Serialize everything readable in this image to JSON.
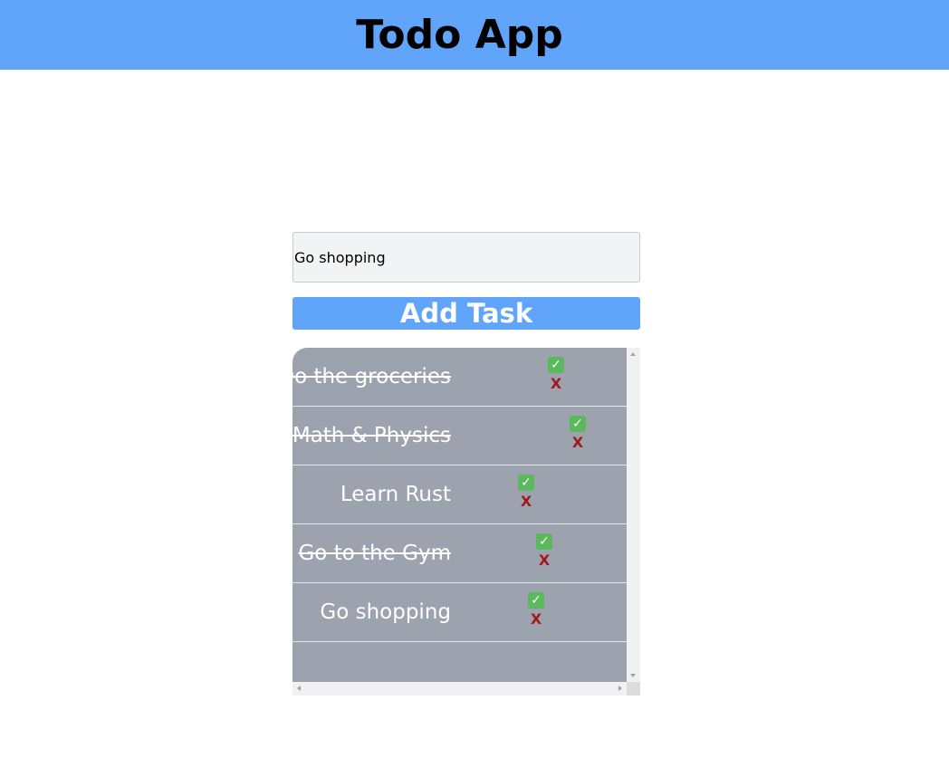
{
  "header": {
    "title": "Todo App",
    "color": "#60a5fa"
  },
  "task_input": {
    "value": "Go shopping",
    "placeholder": ""
  },
  "add_button": {
    "label": "Add Task"
  },
  "task_list": {
    "items": [
      {
        "text": "Do the groceries",
        "completed": true,
        "complete_icon": "check-mark-button-icon",
        "delete_label": "X"
      },
      {
        "text": "Learn Math & Physics",
        "completed": true,
        "complete_icon": "check-mark-button-icon",
        "delete_label": "X"
      },
      {
        "text": "Learn Rust",
        "completed": false,
        "complete_icon": "check-mark-button-icon",
        "delete_label": "X"
      },
      {
        "text": "Go to the Gym",
        "completed": true,
        "complete_icon": "check-mark-button-icon",
        "delete_label": "X"
      },
      {
        "text": "Go shopping",
        "completed": false,
        "complete_icon": "check-mark-button-icon",
        "delete_label": "X"
      }
    ]
  },
  "colors": {
    "accent": "#60a5fa",
    "list_background": "#9ca3af",
    "delete": "#a11a1a",
    "check": "#5cb85c"
  }
}
